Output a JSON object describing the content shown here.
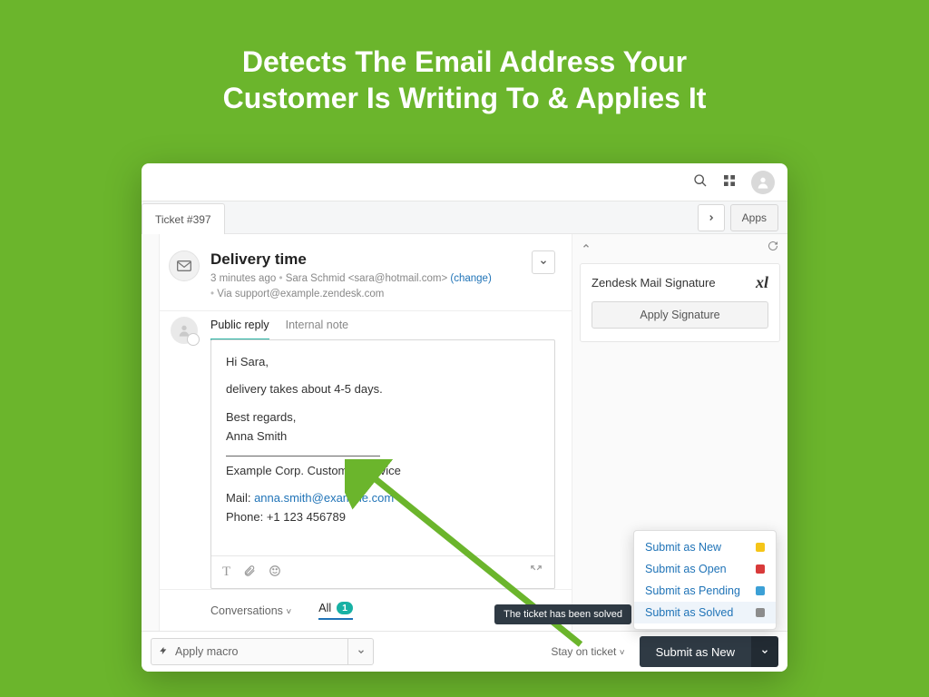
{
  "promo": {
    "title_line1": "Detects The Email Address Your",
    "title_line2": "Customer Is Writing To & Applies It"
  },
  "tabbar": {
    "ticket_tab": "Ticket #397",
    "apps_button": "Apps"
  },
  "ticket": {
    "title": "Delivery time",
    "meta_time": "3 minutes ago",
    "meta_sender": "Sara Schmid <sara@hotmail.com>",
    "meta_change": "(change)",
    "meta_via_prefix": "Via ",
    "meta_via_email": "support@example.zendesk.com"
  },
  "reply_tabs": {
    "public": "Public reply",
    "internal": "Internal note"
  },
  "editor": {
    "greeting": "Hi Sara,",
    "body": "delivery takes about 4-5 days.",
    "signoff": "Best regards,",
    "agent_name": "Anna Smith",
    "company_line": "Example Corp. Customer Service",
    "mail_label": "Mail: ",
    "mail_value": "anna.smith@example.com",
    "phone_label": "Phone: ",
    "phone_value": "+1 123 456789"
  },
  "conversations": {
    "label": "Conversations",
    "all_label": "All",
    "all_count": "1"
  },
  "sidebar": {
    "panel_title": "Zendesk Mail Signature",
    "apply_button": "Apply Signature"
  },
  "submit_menu": {
    "items": [
      {
        "label": "Submit as New",
        "color": "#f5c518"
      },
      {
        "label": "Submit as Open",
        "color": "#d83a3a"
      },
      {
        "label": "Submit as Pending",
        "color": "#3ca0d6"
      },
      {
        "label": "Submit as Solved",
        "color": "#8c8c8c"
      }
    ],
    "tooltip": "The ticket has been solved"
  },
  "bottom": {
    "macro": "Apply macro",
    "stay_label": "Stay on ticket",
    "submit_label": "Submit as New"
  },
  "colors": {
    "brand": "#1f73b7",
    "teal": "#17b1a4"
  }
}
